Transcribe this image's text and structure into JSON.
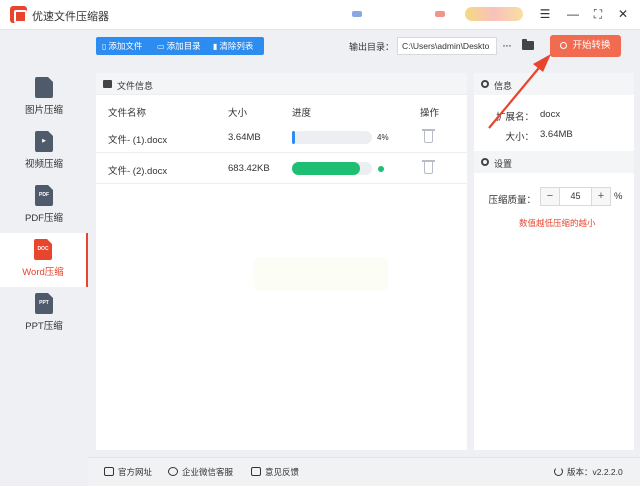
{
  "app": {
    "title": "优速文件压缩器"
  },
  "window_controls": {
    "menu": "☰",
    "minimize": "—",
    "maximize": "⛶",
    "close": "✕"
  },
  "sidebar": {
    "items": [
      {
        "label": "图片压缩",
        "icon": "image-file-icon",
        "icon_text": ""
      },
      {
        "label": "视频压缩",
        "icon": "video-file-icon",
        "icon_text": "▶"
      },
      {
        "label": "PDF压缩",
        "icon": "pdf-file-icon",
        "icon_text": "PDF"
      },
      {
        "label": "Word压缩",
        "icon": "doc-file-icon",
        "icon_text": "DOC",
        "active": true
      },
      {
        "label": "PPT压缩",
        "icon": "ppt-file-icon",
        "icon_text": "PPT"
      }
    ]
  },
  "toolbar": {
    "add_file": "添加文件",
    "add_dir": "添加目录",
    "clear_list": "清除列表",
    "output_label": "输出目录：",
    "output_path": "C:\\Users\\admin\\Deskto",
    "more": "···",
    "start": "开始转换"
  },
  "file_panel": {
    "title": "文件信息",
    "columns": [
      "文件名称",
      "大小",
      "进度",
      "操作"
    ],
    "rows": [
      {
        "name": "文件- (1).docx",
        "size": "3.64MB",
        "progress": 0.04,
        "progress_text": "4%",
        "done": false
      },
      {
        "name": "文件- (2).docx",
        "size": "683.42KB",
        "progress": 0.85,
        "progress_text": "",
        "done": true
      }
    ]
  },
  "info_panel": {
    "title": "信息",
    "ext_label": "扩展名：",
    "ext_value": "docx",
    "size_label": "大小：",
    "size_value": "3.64MB"
  },
  "settings_panel": {
    "title": "设置",
    "quality_label": "压缩质量：",
    "quality_value": "45",
    "minus": "−",
    "plus": "+",
    "unit": "%",
    "hint": "数值越低压缩的越小"
  },
  "footer": {
    "website": "官方网址",
    "wechat": "企业微信客服",
    "feedback": "意见反馈",
    "version": "版本：v2.2.2.0"
  },
  "colors": {
    "accent": "#e8452e",
    "primary": "#2d8cf0",
    "progress_blue": "#2d8cf0",
    "progress_green": "#1fbf73",
    "start_button": "#f06b4f"
  }
}
